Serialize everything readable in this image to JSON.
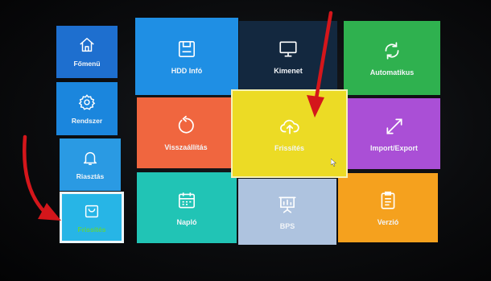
{
  "sidebar": {
    "items": [
      {
        "label": "Főmenü",
        "icon": "home-icon"
      },
      {
        "label": "Rendszer",
        "icon": "gear-icon"
      },
      {
        "label": "Riasztás",
        "icon": "bell-icon"
      },
      {
        "label": "Frissítés",
        "icon": "bag-icon",
        "active": true
      }
    ]
  },
  "tiles": [
    {
      "label": "HDD Infó",
      "icon": "hdd-icon"
    },
    {
      "label": "Kimenet",
      "icon": "monitor-icon"
    },
    {
      "label": "Automatikus",
      "icon": "refresh-icon"
    },
    {
      "label": "Visszaállítás",
      "icon": "restore-icon"
    },
    {
      "label": "Frissítés",
      "icon": "cloud-upload-icon",
      "selected": true
    },
    {
      "label": "Import/Export",
      "icon": "expand-icon"
    },
    {
      "label": "Napló",
      "icon": "calendar-icon"
    },
    {
      "label": "BPS",
      "icon": "chart-board-icon"
    },
    {
      "label": "Verzió",
      "icon": "document-icon"
    }
  ],
  "colors": {
    "annotation_arrow": "#d4161b",
    "active_label": "#5fd34a"
  }
}
